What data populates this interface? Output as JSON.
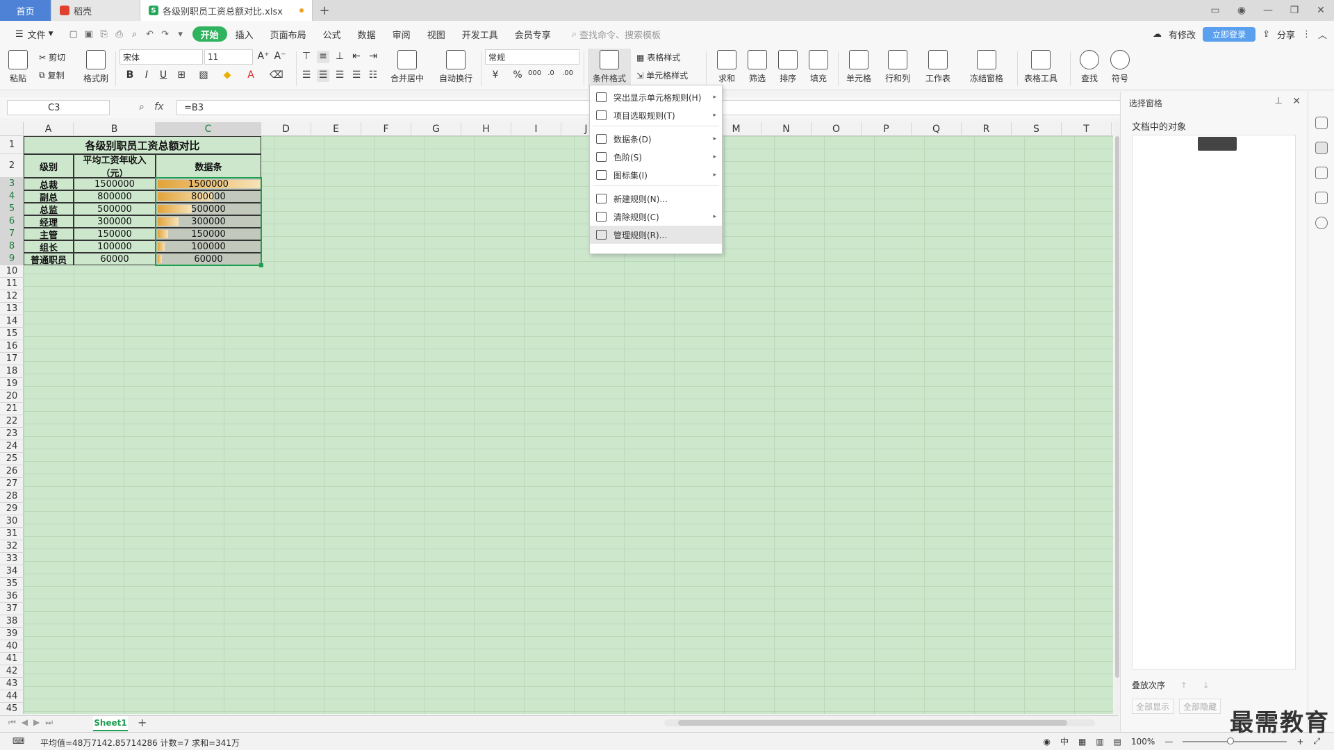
{
  "tabs": {
    "home": "首页",
    "daoke": "稻壳",
    "file": "各级别职员工资总额对比.xlsx",
    "add": "+"
  },
  "menu": {
    "file": "文件",
    "items": [
      "开始",
      "插入",
      "页面布局",
      "公式",
      "数据",
      "审阅",
      "视图",
      "开发工具",
      "会员专享"
    ],
    "search_placeholder": "查找命令、搜索模板",
    "right_unsaved": "有修改",
    "login": "立即登录",
    "share": "分享"
  },
  "ribbon": {
    "paste": "粘贴",
    "cut": "剪切",
    "copy": "复制",
    "format_painter": "格式刷",
    "font_name": "宋体",
    "font_size": "11",
    "merge_center": "合并居中",
    "wrap": "自动换行",
    "number_format": "常规",
    "cond_format": "条件格式",
    "table_style": "表格样式",
    "cell_style": "单元格样式",
    "sum": "求和",
    "filter": "筛选",
    "sort": "排序",
    "fill": "填充",
    "cell": "单元格",
    "row_col": "行和列",
    "worksheet": "工作表",
    "freeze": "冻结窗格",
    "table_tools": "表格工具",
    "find": "查找",
    "symbol": "符号"
  },
  "formula": {
    "name_box": "C3",
    "fx": "fx",
    "content": "=B3"
  },
  "columns": [
    "A",
    "B",
    "C",
    "D",
    "E",
    "F",
    "G",
    "H",
    "I",
    "J",
    "K",
    "L",
    "M",
    "N",
    "O",
    "P",
    "Q",
    "R",
    "S",
    "T"
  ],
  "rows": [
    "1",
    "2",
    "3",
    "4",
    "5",
    "6",
    "7",
    "8",
    "9",
    "10",
    "11",
    "12",
    "13",
    "14",
    "15",
    "16",
    "17",
    "18",
    "19",
    "20",
    "21",
    "22",
    "23",
    "24",
    "25",
    "26",
    "27",
    "28",
    "29",
    "30",
    "31",
    "32",
    "33",
    "34",
    "35",
    "36",
    "37",
    "38",
    "39",
    "40",
    "41",
    "42",
    "43",
    "44",
    "45"
  ],
  "table": {
    "title": "各级别职员工资总额对比",
    "headers": [
      "级别",
      "平均工资年收入（元）",
      "数据条"
    ],
    "rows": [
      {
        "level": "总裁",
        "salary": "1500000",
        "bar": "1500000",
        "fraction": 1.0
      },
      {
        "level": "副总",
        "salary": "800000",
        "bar": "800000",
        "fraction": 0.533
      },
      {
        "level": "总监",
        "salary": "500000",
        "bar": "500000",
        "fraction": 0.333
      },
      {
        "level": "经理",
        "salary": "300000",
        "bar": "300000",
        "fraction": 0.2
      },
      {
        "level": "主管",
        "salary": "150000",
        "bar": "150000",
        "fraction": 0.1
      },
      {
        "level": "组长",
        "salary": "100000",
        "bar": "100000",
        "fraction": 0.067
      },
      {
        "level": "普通职员",
        "salary": "60000",
        "bar": "60000",
        "fraction": 0.04
      }
    ]
  },
  "dropdown": {
    "items": [
      {
        "label": "突出显示单元格规则(H)",
        "submenu": true
      },
      {
        "label": "项目选取规则(T)",
        "submenu": true
      },
      {
        "label": "数据条(D)",
        "submenu": true
      },
      {
        "label": "色阶(S)",
        "submenu": true
      },
      {
        "label": "图标集(I)",
        "submenu": true
      },
      {
        "label": "新建规则(N)...",
        "submenu": false
      },
      {
        "label": "清除规则(C)",
        "submenu": true
      },
      {
        "label": "管理规则(R)...",
        "submenu": false
      }
    ]
  },
  "right_pane": {
    "title": "选择窗格",
    "subtitle": "文档中的对象",
    "order": "叠放次序",
    "show_all": "全部显示",
    "hide_all": "全部隐藏"
  },
  "sheet": {
    "name": "Sheet1",
    "add": "+"
  },
  "status": {
    "text": "平均值=48万7142.85714286  计数=7  求和=341万",
    "zoom": "100%"
  },
  "watermark": "最需教育",
  "colors": {
    "accent": "#2fb35f",
    "grid_bg": "#cde7cd",
    "databar": "#e2a33a",
    "home_tab": "#4d82d6"
  }
}
